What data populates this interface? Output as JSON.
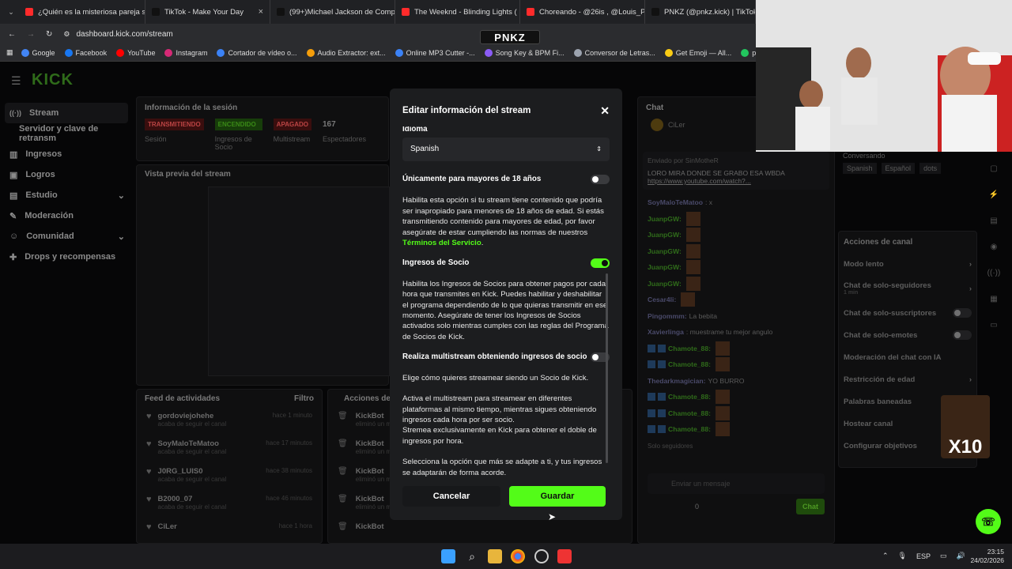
{
  "browser": {
    "tabs": [
      {
        "title": "¿Quién es la misteriosa pareja s",
        "color": "#ff2b2b"
      },
      {
        "title": "TikTok - Make Your Day",
        "color": "#111111"
      },
      {
        "title": "(99+)Michael Jackson de Comp",
        "color": "#111111"
      },
      {
        "title": "The Weeknd - Blinding Lights (",
        "color": "#ff2b2b"
      },
      {
        "title": "Choreando - @26is , @Louis_P",
        "color": "#ff2b2b"
      },
      {
        "title": "PNKZ (@pnkz.kick) | TikTok",
        "color": "#111111"
      }
    ],
    "url": "dashboard.kick.com/stream",
    "bookmarks": [
      "Google",
      "Facebook",
      "YouTube",
      "Instagram",
      "Cortador de vídeo o...",
      "Audio Extractor: ext...",
      "Online MP3 Cutter -...",
      "Song Key & BPM Fi...",
      "Conversor de Letras...",
      "Get Emoji — All...",
      "pnkz_Oficial - Tri"
    ],
    "overlay_logo": "PNKZ"
  },
  "dashboard": {
    "brand": "KICK",
    "sidebar": [
      "Stream",
      "Servidor y clave de retransm",
      "Ingresos",
      "Logros",
      "Estudio",
      "Moderación",
      "Comunidad",
      "Drops y recompensas"
    ],
    "session_title": "Información de la sesión",
    "session_badges": [
      {
        "label": "TRANSMITIENDO",
        "sub": "Sesión"
      },
      {
        "label": "ENCENDIDO",
        "sub": "Ingresos de Socio"
      },
      {
        "label": "APAGADO",
        "sub": "Multistream"
      },
      {
        "label": "167",
        "sub": "Espectadores"
      }
    ],
    "preview_title": "Vista previa del stream",
    "feed_title": "Feed de actividades",
    "feed_filter": "Filtro",
    "feed": [
      {
        "user": "gordoviejohehe",
        "action": "acaba de seguir el canal",
        "time": "hace 1 minuto"
      },
      {
        "user": "SoyMaloTeMatoo",
        "action": "acaba de seguir el canal",
        "time": "hace 17 minutos"
      },
      {
        "user": "J0RG_LUIS0",
        "action": "acaba de seguir el canal",
        "time": "hace 38 minutos"
      },
      {
        "user": "B2000_07",
        "action": "acaba de seguir el canal",
        "time": "hace 46 minutos"
      },
      {
        "user": "CiLer",
        "action": "",
        "time": "hace 1 hora"
      }
    ],
    "mod_actions_title": "Acciones de",
    "mod_actions": [
      {
        "user": "KickBot",
        "action": "eliminó un m"
      },
      {
        "user": "KickBot",
        "action": "eliminó un m"
      },
      {
        "user": "KickBot",
        "action": "eliminó un m"
      },
      {
        "user": "KickBot",
        "action": "eliminó un m"
      },
      {
        "user": "KickBot",
        "action": ""
      }
    ]
  },
  "chat": {
    "title": "Chat",
    "top_user": "CiLer",
    "pinned_by": "Enviado por SinMotheR",
    "pinned_text": "LORO MIRA DONDE SE GRABO ESA WBDA",
    "pinned_link": "https://www.youtube.com/watch?...",
    "messages": [
      {
        "user": "SoyMaloTeMatoo",
        "text": ": x"
      },
      {
        "user": "JuanpGW:",
        "text": ""
      },
      {
        "user": "JuanpGW:",
        "text": ""
      },
      {
        "user": "JuanpGW:",
        "text": ""
      },
      {
        "user": "JuanpGW:",
        "text": ""
      },
      {
        "user": "JuanpGW:",
        "text": ""
      },
      {
        "user": "Cesar4li:",
        "text": ""
      },
      {
        "user": "Pingommm:",
        "text": " La bebita"
      },
      {
        "user": "Xavierlinga",
        "text": ": muestrame tu mejor angulo"
      },
      {
        "user": "Chamote_88:",
        "text": ""
      },
      {
        "user": "Chamote_88:",
        "text": ""
      },
      {
        "user": "Thedarkmagician:",
        "text": " YO BURRO"
      },
      {
        "user": "Chamote_88:",
        "text": ""
      },
      {
        "user": "Chamote_88:",
        "text": ""
      },
      {
        "user": "Chamote_88:",
        "text": ""
      }
    ],
    "followers_only": "Solo seguidores",
    "input_placeholder": "Enviar un mensaje",
    "points": "0",
    "send": "Chat"
  },
  "channel": {
    "conversing": "Conversando",
    "tags": [
      "Spanish",
      "Español",
      "dots"
    ],
    "actions_title": "Acciones de canal",
    "actions": [
      "Modo lento",
      "Chat de solo-seguidores",
      "Chat de solo-suscriptores",
      "Chat de solo-emotes",
      "Moderación del chat con IA",
      "Restricción de edad",
      "Palabras baneadas",
      "Hostear canal",
      "Configurar objetivos"
    ],
    "followers_sub": "1 min",
    "sticker": "X10"
  },
  "modal": {
    "title": "Editar información del stream",
    "language_label": "Idioma",
    "language_value": "Spanish",
    "adult_label": "Únicamente para mayores de 18 años",
    "adult_desc": "Habilita esta opción si tu stream tiene contenido que podría ser inapropiado para menores de 18 años de edad. Si estás transmitiendo contenido para mayores de edad, por favor asegúrate de estar cumpliendo las normas de nuestros ",
    "adult_link": "Términos del Servicio",
    "partner_label": "Ingresos de Socio",
    "partner_desc": "Habilita los Ingresos de Socios para obtener pagos por cada hora que transmites en Kick. Puedes habilitar y deshabilitar el programa dependiendo de lo que quieras transmitir en ese momento. Asegúrate de tener los Ingresos de Socios activados solo mientras cumples con las reglas del Programa de Socios de Kick.",
    "multistream_label": "Realiza multistream obteniendo ingresos de socio",
    "choose_text": "Elige cómo quieres streamear siendo un Socio de Kick.",
    "multistream_desc_1": "Activa el multistream para streamear en diferentes plataformas al mismo tiempo, mientras sigues obteniendo ingresos cada hora por ser socio.",
    "multistream_desc_2": "Stremea exclusivamente en Kick para obtener el doble de ingresos por hora.",
    "select_text": "Selecciona la opción que más se adapte a ti, y tus ingresos se adaptarán de forma acorde.",
    "cancel": "Cancelar",
    "save": "Guardar",
    "adult_on": false,
    "partner_on": true,
    "multistream_on": false
  },
  "taskbar": {
    "lang": "ESP",
    "time": "23:15",
    "date": "24/02/2026"
  },
  "colors": {
    "kick_green": "#53fc18",
    "live_red": "#ff4d4d"
  }
}
